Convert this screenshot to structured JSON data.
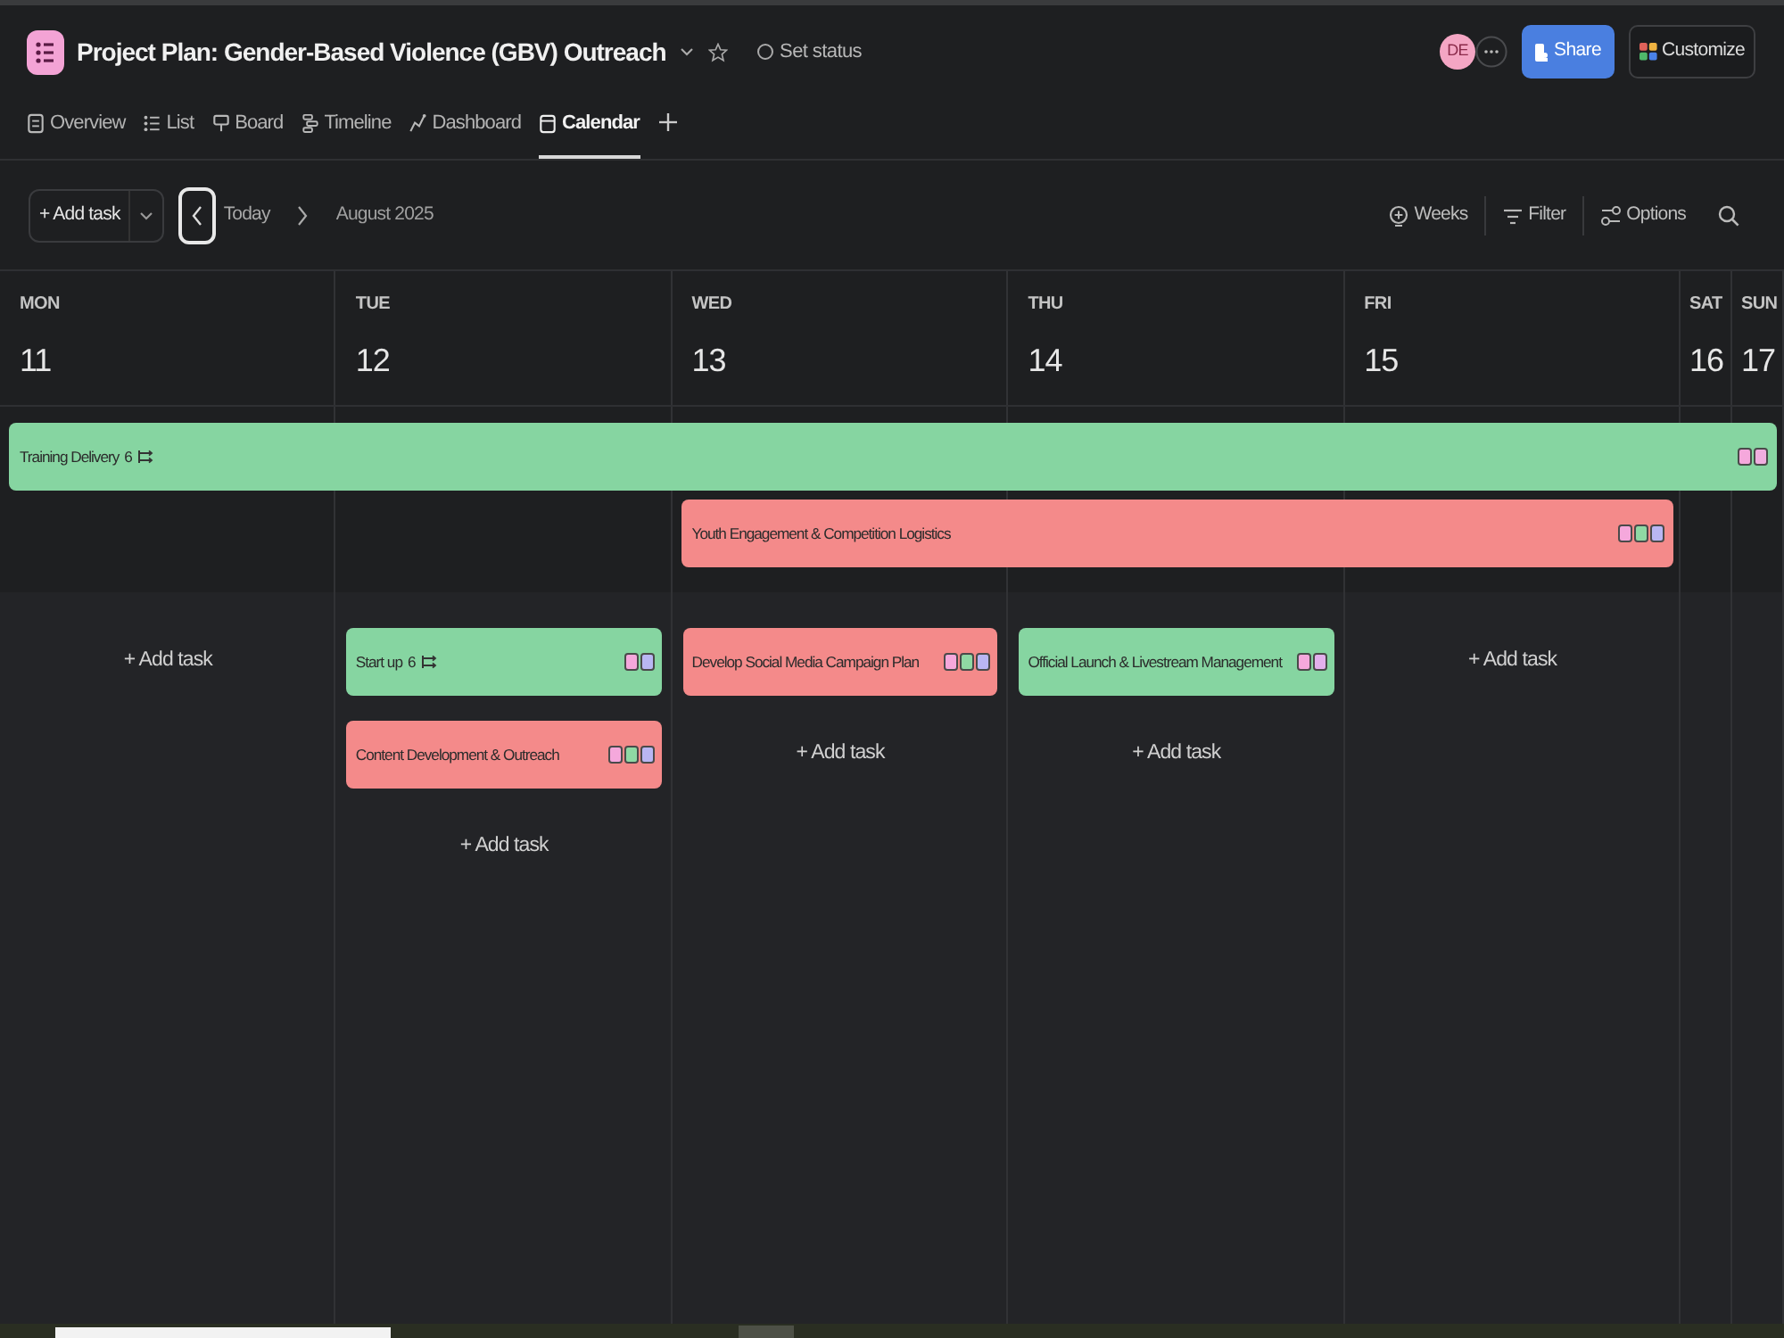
{
  "header": {
    "title": "Project Plan: Gender-Based Violence (GBV) Outreach",
    "status": "Set status",
    "avatar": "DE",
    "share": "Share",
    "customize": "Customize"
  },
  "tabs": [
    {
      "label": "Overview",
      "kind": "overview",
      "selected": false
    },
    {
      "label": "List",
      "kind": "list",
      "selected": false
    },
    {
      "label": "Board",
      "kind": "board",
      "selected": false
    },
    {
      "label": "Timeline",
      "kind": "timeline",
      "selected": false
    },
    {
      "label": "Dashboard",
      "kind": "dashboard",
      "selected": false
    },
    {
      "label": "Calendar",
      "kind": "calendar",
      "selected": true
    }
  ],
  "toolbar": {
    "add_task": "+ Add task",
    "prev_focused": true,
    "today": "Today",
    "period": "August 2025",
    "actions": [
      {
        "label": "Weeks",
        "kind": "weeks"
      },
      {
        "label": "Filter",
        "kind": "filter"
      },
      {
        "label": "Options",
        "kind": "options"
      }
    ]
  },
  "calendar": {
    "days": [
      {
        "name": "MON",
        "date": "11",
        "collapsed": false,
        "spanning_tasks": [
          {
            "title": "Training Delivery",
            "subtasks": "6",
            "color": "#86d5a1",
            "spans_weekend": true,
            "markers": [
              {
                "color": "#f5a8dc"
              },
              {
                "color": "#f0aee0"
              }
            ]
          }
        ],
        "add_task": "+ Add task"
      },
      {
        "name": "TUE",
        "date": "12",
        "collapsed": false,
        "tasks": [
          {
            "title": "Start up",
            "subtasks": "6",
            "color": "#86d5a1",
            "markers": [
              {
                "color": "#f5a8dc"
              },
              {
                "color": "#b9b6f3"
              }
            ]
          },
          {
            "title": "Content Development & Outreach",
            "color": "#f48a8a",
            "markers": [
              {
                "color": "#f5a8dc"
              },
              {
                "color": "#8fd8a4"
              },
              {
                "color": "#b9b6f3"
              }
            ]
          }
        ],
        "add_task": "+ Add task"
      },
      {
        "name": "WED",
        "date": "13",
        "collapsed": false,
        "spanning_tasks": [
          {
            "title": "Youth Engagement & Competition Logistics",
            "color": "#f48a8a",
            "spans_weekend": false,
            "markers": [
              {
                "color": "#f5a8dc"
              },
              {
                "color": "#8fd8a4"
              },
              {
                "color": "#b9b6f3"
              }
            ]
          }
        ],
        "tasks": [
          {
            "title": "Develop Social Media Campaign Plan",
            "color": "#f48a8a",
            "markers": [
              {
                "color": "#f5a8dc"
              },
              {
                "color": "#8fd8a4"
              },
              {
                "color": "#b9b6f3"
              }
            ]
          }
        ],
        "add_task": "+ Add task"
      },
      {
        "name": "THU",
        "date": "14",
        "collapsed": false,
        "tasks": [
          {
            "title": "Official Launch & Livestream Management",
            "color": "#86d5a1",
            "markers": [
              {
                "color": "#f5a8dc"
              },
              {
                "color": "#e3b0ec"
              }
            ]
          }
        ],
        "add_task": "+ Add task"
      },
      {
        "name": "FRI",
        "date": "15",
        "collapsed": false,
        "add_task": "+ Add task"
      },
      {
        "name": "SAT",
        "date": "16",
        "collapsed": true
      },
      {
        "name": "SUN",
        "date": "17",
        "collapsed": true
      }
    ]
  }
}
